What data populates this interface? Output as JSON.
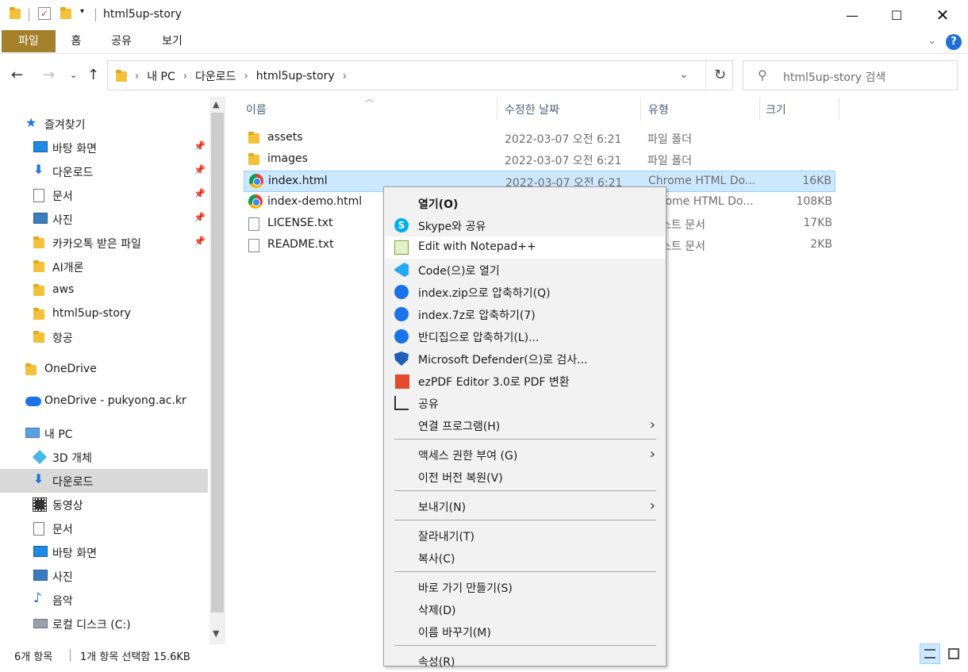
{
  "window": {
    "title": "html5up-story"
  },
  "ribbon": {
    "tabs": [
      "파일",
      "홈",
      "공유",
      "보기"
    ],
    "help": "?"
  },
  "address": {
    "crumbs": [
      "내 PC",
      "다운로드",
      "html5up-story"
    ]
  },
  "search": {
    "placeholder": "html5up-story 검색"
  },
  "nav": {
    "quick_access": "즐겨찾기",
    "items": [
      {
        "label": "바탕 화면",
        "icon": "desktop-icon"
      },
      {
        "label": "다운로드",
        "icon": "download-icon"
      },
      {
        "label": "문서",
        "icon": "document-icon"
      },
      {
        "label": "사진",
        "icon": "pictures-icon"
      },
      {
        "label": "카카오톡 받은 파일",
        "icon": "folder-icon"
      },
      {
        "label": "AI개론",
        "icon": "folder-icon"
      },
      {
        "label": "aws",
        "icon": "folder-icon"
      },
      {
        "label": "html5up-story",
        "icon": "folder-icon"
      },
      {
        "label": "항공",
        "icon": "folder-icon"
      }
    ],
    "onedrive": "OneDrive",
    "onedrive_org": "OneDrive - pukyong.ac.kr",
    "this_pc": "내 PC",
    "pc_items": [
      {
        "label": "3D 개체",
        "icon": "3d-objects-icon"
      },
      {
        "label": "다운로드",
        "icon": "download-icon"
      },
      {
        "label": "동영상",
        "icon": "videos-icon"
      },
      {
        "label": "문서",
        "icon": "document-icon"
      },
      {
        "label": "바탕 화면",
        "icon": "desktop-icon"
      },
      {
        "label": "사진",
        "icon": "pictures-icon"
      },
      {
        "label": "음악",
        "icon": "music-icon"
      },
      {
        "label": "로컬 디스크 (C:)",
        "icon": "drive-icon"
      }
    ]
  },
  "columns": {
    "name": "이름",
    "date": "수정한 날짜",
    "type": "유형",
    "size": "크기"
  },
  "files": [
    {
      "name": "assets",
      "date": "2022-03-07 오전 6:21",
      "type": "파일 폴더",
      "size": ""
    },
    {
      "name": "images",
      "date": "2022-03-07 오전 6:21",
      "type": "파일 폴더",
      "size": ""
    },
    {
      "name": "index.html",
      "date": "2022-03-07 오전 6:21",
      "type": "Chrome HTML Do...",
      "size": "16KB"
    },
    {
      "name": "index-demo.html",
      "date": "",
      "type": "rome HTML Do...",
      "size": "108KB"
    },
    {
      "name": "LICENSE.txt",
      "date": "",
      "type": "스트 문서",
      "size": "17KB"
    },
    {
      "name": "README.txt",
      "date": "",
      "type": "스트 문서",
      "size": "2KB"
    }
  ],
  "context_menu": {
    "open": "열기(O)",
    "skype": "Skype와 공유",
    "notepad": "Edit with Notepad++",
    "code": "Code(으)로 열기",
    "zip": "index.zip으로 압축하기(Q)",
    "sevenz": "index.7z로 압축하기(7)",
    "bandizip": "반디집으로 압축하기(L)...",
    "defender": "Microsoft Defender(으)로 검사...",
    "ezpdf": "ezPDF Editor 3.0로 PDF 변환",
    "share": "공유",
    "open_with": "연결 프로그램(H)",
    "access": "액세스 권한 부여 (G)",
    "restore": "이전 버전 복원(V)",
    "send_to": "보내기(N)",
    "cut": "잘라내기(T)",
    "copy": "복사(C)",
    "shortcut": "바로 가기 만들기(S)",
    "delete": "삭제(D)",
    "rename": "이름 바꾸기(M)",
    "properties": "속성(R)"
  },
  "status": {
    "count": "6개 항목",
    "selected": "1개 항목 선택함 15.6KB"
  },
  "colors": {
    "file_tab": "#a5802a",
    "selection": "#cce8ff",
    "folder": "#f4c13b",
    "accent": "#1a73e8"
  }
}
